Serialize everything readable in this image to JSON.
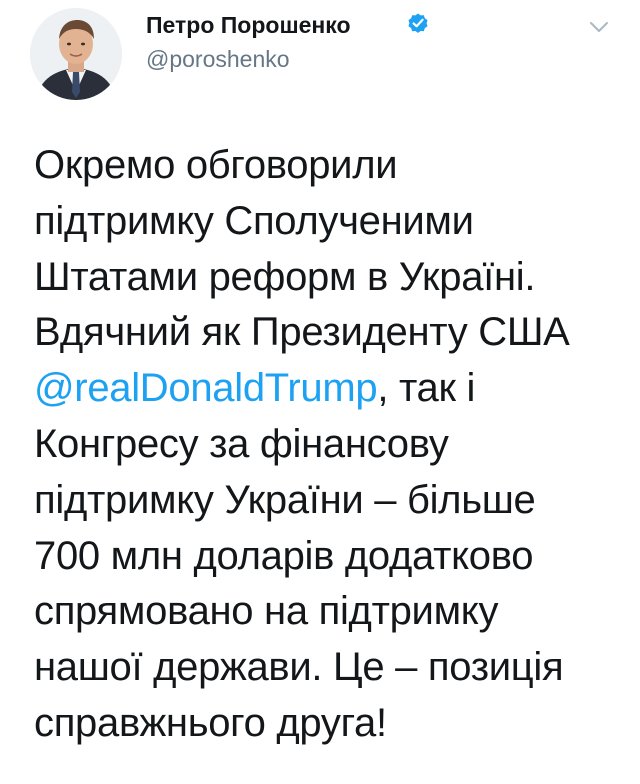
{
  "author": {
    "display_name": "Петро Порошенко",
    "handle": "@poroshenko",
    "verified": true,
    "avatar": "profile-photo"
  },
  "menu": {
    "icon": "chevron-down-icon"
  },
  "tweet": {
    "lines": [
      "Окремо обговорили",
      "підтримку Сполученими",
      "Штатами реформ в Україні.",
      "Вдячний як Президенту США",
      "",
      "Конгресу за фінансову",
      "підтримку України – більше",
      "700 млн доларів додатково",
      "спрямовано на підтримку",
      "нашої держави. Це – позиція",
      "справжнього друга!"
    ],
    "mention": "@realDonaldTrump",
    "mention_suffix": ", так і"
  },
  "colors": {
    "text": "#14171a",
    "secondary": "#657786",
    "link": "#1da1f2",
    "verified_badge": "#1da1f2"
  }
}
